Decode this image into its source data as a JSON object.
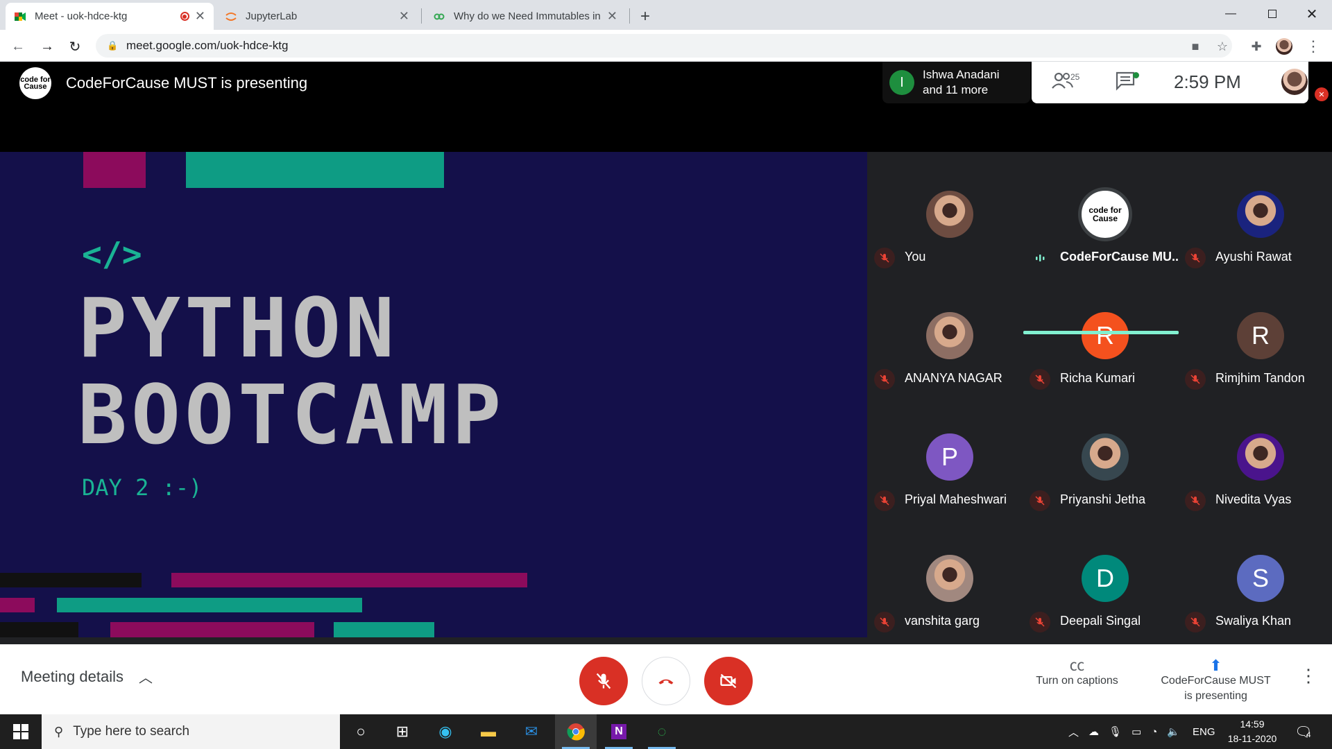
{
  "browser": {
    "tabs": [
      {
        "title": "Meet - uok-hdce-ktg",
        "active": true
      },
      {
        "title": "JupyterLab",
        "active": false
      },
      {
        "title": "Why do we Need Immutables in",
        "active": false
      }
    ],
    "new_tab": "+",
    "url": "meet.google.com/uok-hdce-ktg"
  },
  "meet": {
    "presenter_banner": "CodeForCause MUST is presenting",
    "presenter_logo_text": "code for Cause",
    "participants_summary": {
      "initial": "I",
      "line1": "Ishwa Anadani",
      "line2": "and 11 more"
    },
    "participant_count": "25",
    "time": "2:59 PM",
    "you_label": "You",
    "slide": {
      "code_symbol": "</>",
      "title_line1": "PYTHON",
      "title_line2": "BOOTCAMP",
      "subtitle": "DAY 2 :-)"
    },
    "participants": [
      {
        "name": "You",
        "initial": "",
        "color": "#6d4c41"
      },
      {
        "name": "CodeForCause MU...",
        "initial": "",
        "color": "#ffffff"
      },
      {
        "name": "Ayushi Rawat",
        "initial": "",
        "color": "#1a237e"
      },
      {
        "name": "ANANYA NAGAR",
        "initial": "",
        "color": "#8d6e63"
      },
      {
        "name": "Richa Kumari",
        "initial": "R",
        "color": "#f4511e"
      },
      {
        "name": "Rimjhim Tandon",
        "initial": "R",
        "color": "#5d4037"
      },
      {
        "name": "Priyal Maheshwari",
        "initial": "P",
        "color": "#7e57c2"
      },
      {
        "name": "Priyanshi Jetha",
        "initial": "",
        "color": "#37474f"
      },
      {
        "name": "Nivedita Vyas",
        "initial": "",
        "color": "#4a148c"
      },
      {
        "name": "vanshita garg",
        "initial": "",
        "color": "#a1887f"
      },
      {
        "name": "Deepali Singal",
        "initial": "D",
        "color": "#00897b"
      },
      {
        "name": "Swaliya Khan",
        "initial": "S",
        "color": "#5c6bc0"
      }
    ],
    "controls": {
      "meeting_details": "Meeting details",
      "captions": "Turn on captions",
      "presenting_line1": "CodeForCause MUST",
      "presenting_line2": "is presenting"
    }
  },
  "taskbar": {
    "search_placeholder": "Type here to search",
    "lang": "ENG",
    "time": "14:59",
    "date": "18-11-2020",
    "notifications": "4"
  }
}
